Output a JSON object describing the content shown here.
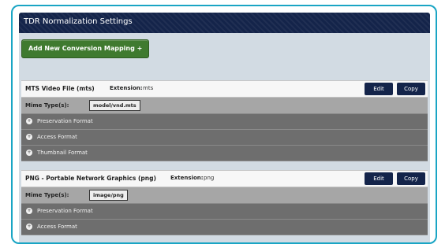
{
  "header": {
    "title": "TDR Normalization Settings"
  },
  "toolbar": {
    "add_label": "Add New Conversion Mapping +"
  },
  "mappings": [
    {
      "name": "MTS Video File (mts)",
      "extension_label": "Extension:",
      "extension": "mts",
      "edit_label": "Edit",
      "copy_label": "Copy",
      "mime_label": "Mime Type(s):",
      "mime_value": "model/vnd.mts",
      "formats": [
        "Preservation Format",
        "Access Format",
        "Thumbnail Format"
      ]
    },
    {
      "name": "PNG - Portable Network Graphics (png)",
      "extension_label": "Extension:",
      "extension": "png",
      "edit_label": "Edit",
      "copy_label": "Copy",
      "mime_label": "Mime Type(s):",
      "mime_value": "image/png",
      "formats": [
        "Preservation Format",
        "Access Format"
      ]
    }
  ],
  "colors": {
    "header": "#14244a",
    "add_button": "#3f7a2f",
    "frame_border": "#1aa5c4",
    "format_row": "#6e6e6e"
  }
}
